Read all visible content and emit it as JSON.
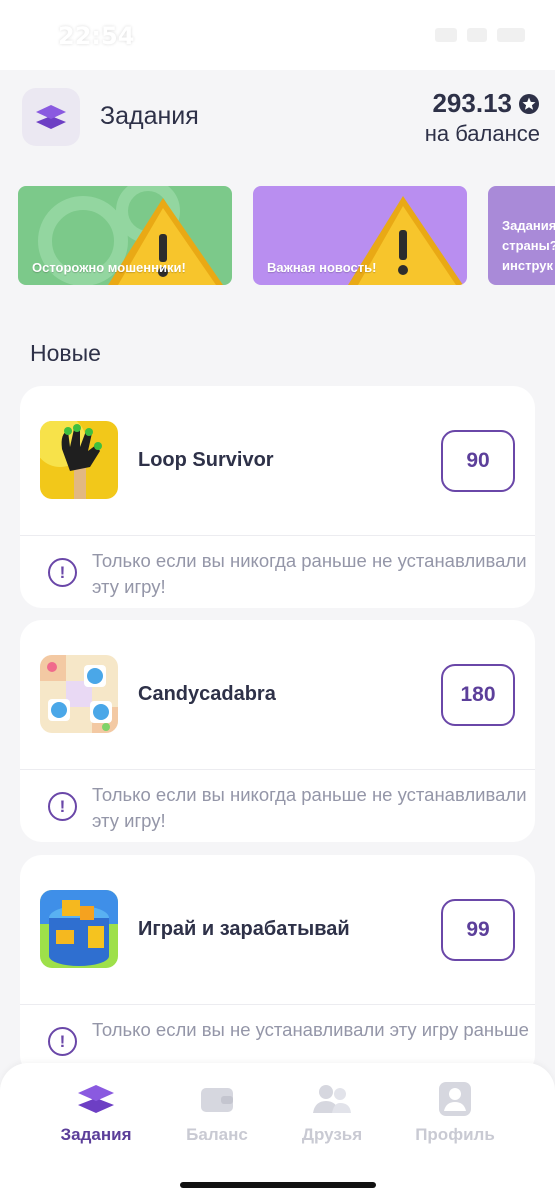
{
  "status_bar": {
    "time": "22:54"
  },
  "header": {
    "title": "Задания",
    "balance": "293.13",
    "balance_caption": "на балансе",
    "balance_icon": "star-coin-icon"
  },
  "banners": [
    {
      "label": "Осторожно мошенники!",
      "color": "#7cc98a"
    },
    {
      "label": "Важная новость!",
      "color": "#b98ef0"
    },
    {
      "label_lines": [
        "Задания",
        "страны?",
        "инструк"
      ],
      "color": "#a98ad8"
    }
  ],
  "section": {
    "title": "Новые"
  },
  "tasks": [
    {
      "title": "Loop Survivor",
      "reward": "90",
      "note": "Только если вы никогда раньше не устанавливали эту игру!"
    },
    {
      "title": "Candycadabra",
      "reward": "180",
      "note": "Только если вы никогда раньше не устанавливали эту игру!"
    },
    {
      "title": "Играй и зарабатывай",
      "reward": "99",
      "note": "Только если вы не устанавливали эту игру раньше"
    }
  ],
  "nav": {
    "items": [
      {
        "label": "Задания",
        "icon": "layers-icon",
        "active": true
      },
      {
        "label": "Баланс",
        "icon": "wallet-icon",
        "active": false
      },
      {
        "label": "Друзья",
        "icon": "friends-icon",
        "active": false
      },
      {
        "label": "Профиль",
        "icon": "profile-icon",
        "active": false
      }
    ]
  },
  "colors": {
    "accent": "#5c3f9a",
    "inactive": "#c9cad3"
  }
}
